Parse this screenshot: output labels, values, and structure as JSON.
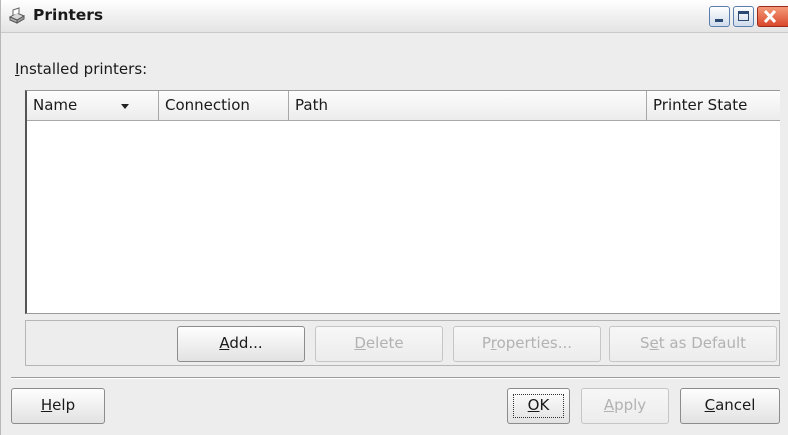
{
  "window": {
    "title": "Printers",
    "icon": "printer-icon"
  },
  "label": {
    "prefix": "I",
    "rest": "nstalled printers:"
  },
  "table": {
    "columns": [
      "Name",
      "Connection",
      "Path",
      "Printer State"
    ],
    "sort_column": "Name",
    "sort_direction": "descending",
    "rows": []
  },
  "buttons": {
    "add": {
      "mnemonic": "A",
      "rest": "dd..."
    },
    "delete": {
      "mnemonic": "D",
      "rest": "elete"
    },
    "properties": {
      "pre": "P",
      "mnemonic": "r",
      "rest": "operties..."
    },
    "set_default": {
      "pre": "S",
      "mnemonic": "e",
      "rest": "t as Default"
    },
    "help": {
      "mnemonic": "H",
      "rest": "elp"
    },
    "ok": {
      "mnemonic": "O",
      "rest": "K"
    },
    "apply": {
      "mnemonic": "A",
      "rest": "pply"
    },
    "cancel": {
      "mnemonic": "C",
      "rest": "ancel"
    }
  },
  "colors": {
    "window_bg": "#ededed",
    "disabled_text": "#b2b2b2",
    "close_button": "#d9472c"
  }
}
